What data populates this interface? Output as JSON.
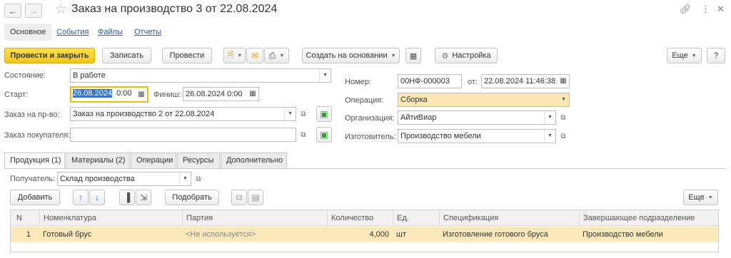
{
  "window": {
    "title": "Заказ на производство 3 от 22.08.2024"
  },
  "subtabs": [
    {
      "label": "Основное"
    },
    {
      "label": "События"
    },
    {
      "label": "Файлы"
    },
    {
      "label": "Отчеты"
    }
  ],
  "toolbar": {
    "post_close": "Провести и закрыть",
    "save": "Записать",
    "post": "Провести",
    "create_based": "Создать на основании",
    "settings": "Настройка",
    "more": "Еще",
    "help": "?"
  },
  "form": {
    "state_label": "Состояние:",
    "state_value": "В работе",
    "start_label": "Старт:",
    "start_date": "26.08.2024",
    "start_time": "0:00",
    "finish_label": "Финиш:",
    "finish_value": "26.08.2024  0:00",
    "order_label": "Заказ на пр-во:",
    "order_value": "Заказ на производство 2 от 22.08.2024",
    "buyer_order_label": "Заказ покупателя:",
    "buyer_order_value": "",
    "number_label": "Номер:",
    "number_value": "00НФ-000003",
    "from_label": "от:",
    "from_value": "22.08.2024 11:46:38",
    "operation_label": "Операция:",
    "operation_value": "Сборка",
    "organization_label": "Организация:",
    "organization_value": "АйтиВиар",
    "manufacturer_label": "Изготовитель:",
    "manufacturer_value": "Производство мебели"
  },
  "tabs": [
    {
      "label": "Продукция (1)"
    },
    {
      "label": "Материалы (2)"
    },
    {
      "label": "Операции"
    },
    {
      "label": "Ресурсы"
    },
    {
      "label": "Дополнительно"
    }
  ],
  "products": {
    "recipient_label": "Получатель:",
    "recipient_value": "Склад производства",
    "add": "Добавить",
    "pick": "Подобрать",
    "more": "Еще",
    "columns": [
      "N",
      "Номенклатура",
      "Партия",
      "Количество",
      "Ед.",
      "Спецификация",
      "Завершающее подразделение"
    ],
    "rows": [
      [
        "1",
        "Готовый брус",
        "<Не используется>",
        "4,000",
        "шт",
        "Изготовление готового бруса",
        "Производство мебели"
      ]
    ]
  },
  "colors": {
    "primary_button": "#f3c51a",
    "selected_row": "#fbe9bb",
    "link": "#2b5ea8",
    "selection": "#3874c8"
  }
}
